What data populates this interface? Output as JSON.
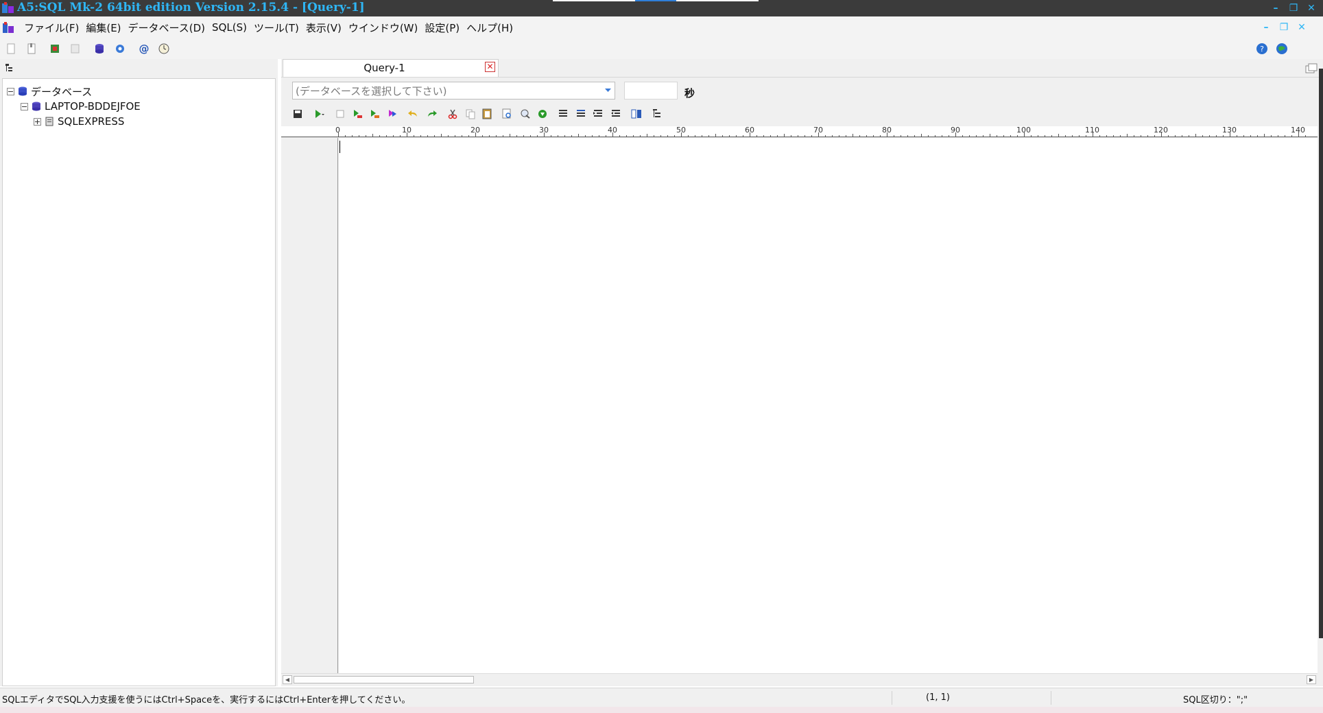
{
  "window": {
    "title": "A5:SQL Mk-2 64bit edition Version 2.15.4 - [Query-1]",
    "controls": [
      "minimize-icon",
      "restore-icon",
      "close-icon"
    ]
  },
  "menu": {
    "items": [
      "ファイル(F)",
      "編集(E)",
      "データベース(D)",
      "SQL(S)",
      "ツール(T)",
      "表示(V)",
      "ウインドウ(W)",
      "設定(P)",
      "ヘルプ(H)"
    ]
  },
  "toolbar": {
    "icons": [
      "new-file-icon",
      "open-file-icon",
      "export-icon",
      "copy-db-icon",
      "database-icon",
      "settings-gear-icon",
      "at-sign-icon",
      "clock-icon"
    ],
    "right_icons": [
      "help-icon",
      "web-icon"
    ]
  },
  "tree": {
    "root": "データベース",
    "host": "LAPTOP-BDDEJFOE",
    "instance": "SQLEXPRESS"
  },
  "query": {
    "tab_label": "Query-1",
    "db_select_placeholder": "(データベースを選択して下さい)",
    "seconds_value": "",
    "seconds_label": "秒",
    "toolbar_icons": [
      "save-icon",
      "run-icon",
      "stop-icon",
      "run-step-icon",
      "run-csv-icon",
      "run-all-icon",
      "undo-icon",
      "redo-icon",
      "cut-icon",
      "copy-icon",
      "paste-icon",
      "find-icon",
      "replace-icon",
      "go-icon",
      "align-icon",
      "wrap-icon",
      "indent-icon",
      "outdent-icon",
      "compare-icon",
      "tree-icon"
    ]
  },
  "ruler": {
    "labels": [
      "0",
      "10",
      "20",
      "30",
      "40",
      "50",
      "60",
      "70",
      "80",
      "90",
      "100",
      "110",
      "120",
      "130",
      "140"
    ]
  },
  "status": {
    "hint": "SQLエディタでSQL入力支援を使うにはCtrl+Spaceを、実行するにはCtrl+Enterを押してください。",
    "cursor": "(1, 1)",
    "delimiter": "SQL区切り：\";\""
  },
  "colors": {
    "title_bar": "#3b3b3b",
    "title_text": "#2fb6f5",
    "panel": "#f0f0f0"
  }
}
